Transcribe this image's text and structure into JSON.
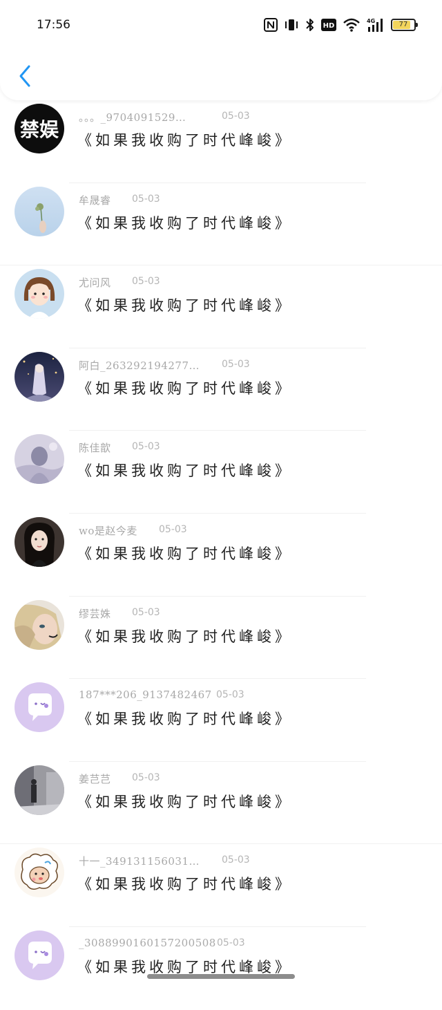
{
  "status_bar": {
    "time": "17:56",
    "battery": "77",
    "icons": [
      "nfc-icon",
      "vibrate-icon",
      "bluetooth-icon",
      "hd-icon",
      "wifi-icon",
      "signal-4g-icon",
      "battery-icon"
    ]
  },
  "header": {
    "back_icon": "chevron-left-icon",
    "accent_color": "#2196f3"
  },
  "comments": [
    {
      "name": "。。。_9704091529…",
      "date": "05-03",
      "text": "《如果我收购了时代峰峻》",
      "avatar_text": "禁娱",
      "avatar": "ban-logo"
    },
    {
      "name": "牟晟睿",
      "date": "05-03",
      "text": "《如果我收购了时代峰峻》",
      "avatar": "flower-sky"
    },
    {
      "name": "尤问风",
      "date": "05-03",
      "text": "《如果我收购了时代峰峻》",
      "avatar": "cartoon-girl"
    },
    {
      "name": "阿白_263292194277…",
      "date": "05-03",
      "text": "《如果我收购了时代峰峻》",
      "avatar": "night-girl"
    },
    {
      "name": "陈佳歆",
      "date": "05-03",
      "text": "《如果我收购了时代峰峻》",
      "avatar": "purple-photo"
    },
    {
      "name": "wo是赵今麦",
      "date": "05-03",
      "text": "《如果我收购了时代峰峻》",
      "avatar": "portrait-girl"
    },
    {
      "name": "缪芸姝",
      "date": "05-03",
      "text": "《如果我收购了时代峰峻》",
      "avatar": "blonde-face"
    },
    {
      "name": "187***206_9137482467",
      "date": "05-03",
      "text": "《如果我收购了时代峰峻》",
      "avatar": "default-chat"
    },
    {
      "name": "姜芑芑",
      "date": "05-03",
      "text": "《如果我收购了时代峰峻》",
      "avatar": "street-photo"
    },
    {
      "name": "十一_349131156031…",
      "date": "05-03",
      "text": "《如果我收购了时代峰峻》",
      "avatar": "cartoon-sheep"
    },
    {
      "name": "_3088990160157200508",
      "date": "05-03",
      "text": "《如果我收购了时代峰峻》",
      "avatar": "default-chat"
    }
  ]
}
